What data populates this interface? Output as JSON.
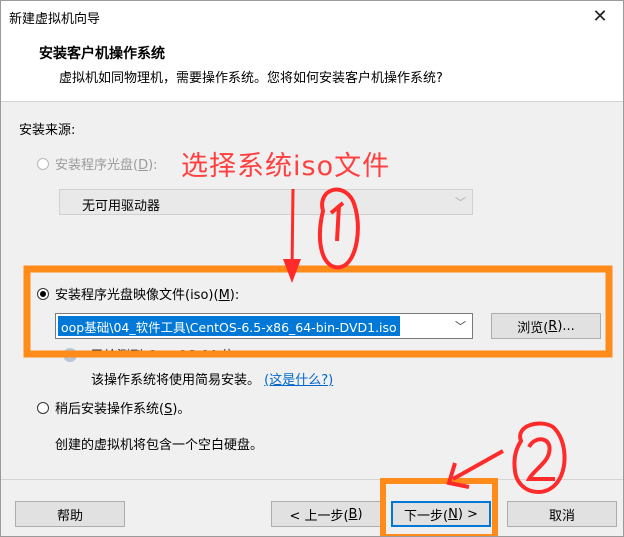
{
  "window": {
    "title": "新建虚拟机向导"
  },
  "header": {
    "title": "安装客户机操作系统",
    "subtitle": "虚拟机如同物理机，需要操作系统。您将如何安装客户机操作系统?"
  },
  "install_source": {
    "label": "安装来源:",
    "disc_option": {
      "label": "安装程序光盘(",
      "key": "D",
      "suffix": "):",
      "selected": false,
      "enabled": false
    },
    "disc_drive": {
      "value": "无可用驱动器"
    },
    "iso_option": {
      "label": "安装程序光盘映像文件(iso)(",
      "key": "M",
      "suffix": "):",
      "selected": true
    },
    "iso_path": {
      "value": "oop基础\\04_软件工具\\CentOS-6.5-x86_64-bin-DVD1.iso"
    },
    "browse_button": {
      "label": "浏览(",
      "key": "R",
      "suffix": ")..."
    },
    "detected_text": "已检测到 CentOS 64 位",
    "easy_install_text": "该操作系统将使用简易安装。",
    "what_is_this_link": "(这是什么?)",
    "later_option": {
      "label": "稍后安装操作系统(",
      "key": "S",
      "suffix": ")。",
      "selected": false
    },
    "later_description": "创建的虚拟机将包含一个空白硬盘。"
  },
  "annotations": {
    "text": "选择系统iso文件",
    "step1": "①",
    "step2": "②",
    "color": "#ff4040",
    "highlight_color": "#ff8c1a"
  },
  "footer": {
    "help": "帮助",
    "back": {
      "label": "< 上一步(",
      "key": "B",
      "suffix": ")"
    },
    "next": {
      "label": "下一步(",
      "key": "N",
      "suffix": ") >"
    },
    "cancel": "取消"
  },
  "icons": {
    "close": "close-icon",
    "info": "info-icon",
    "chevron": "chevron-down-icon"
  }
}
